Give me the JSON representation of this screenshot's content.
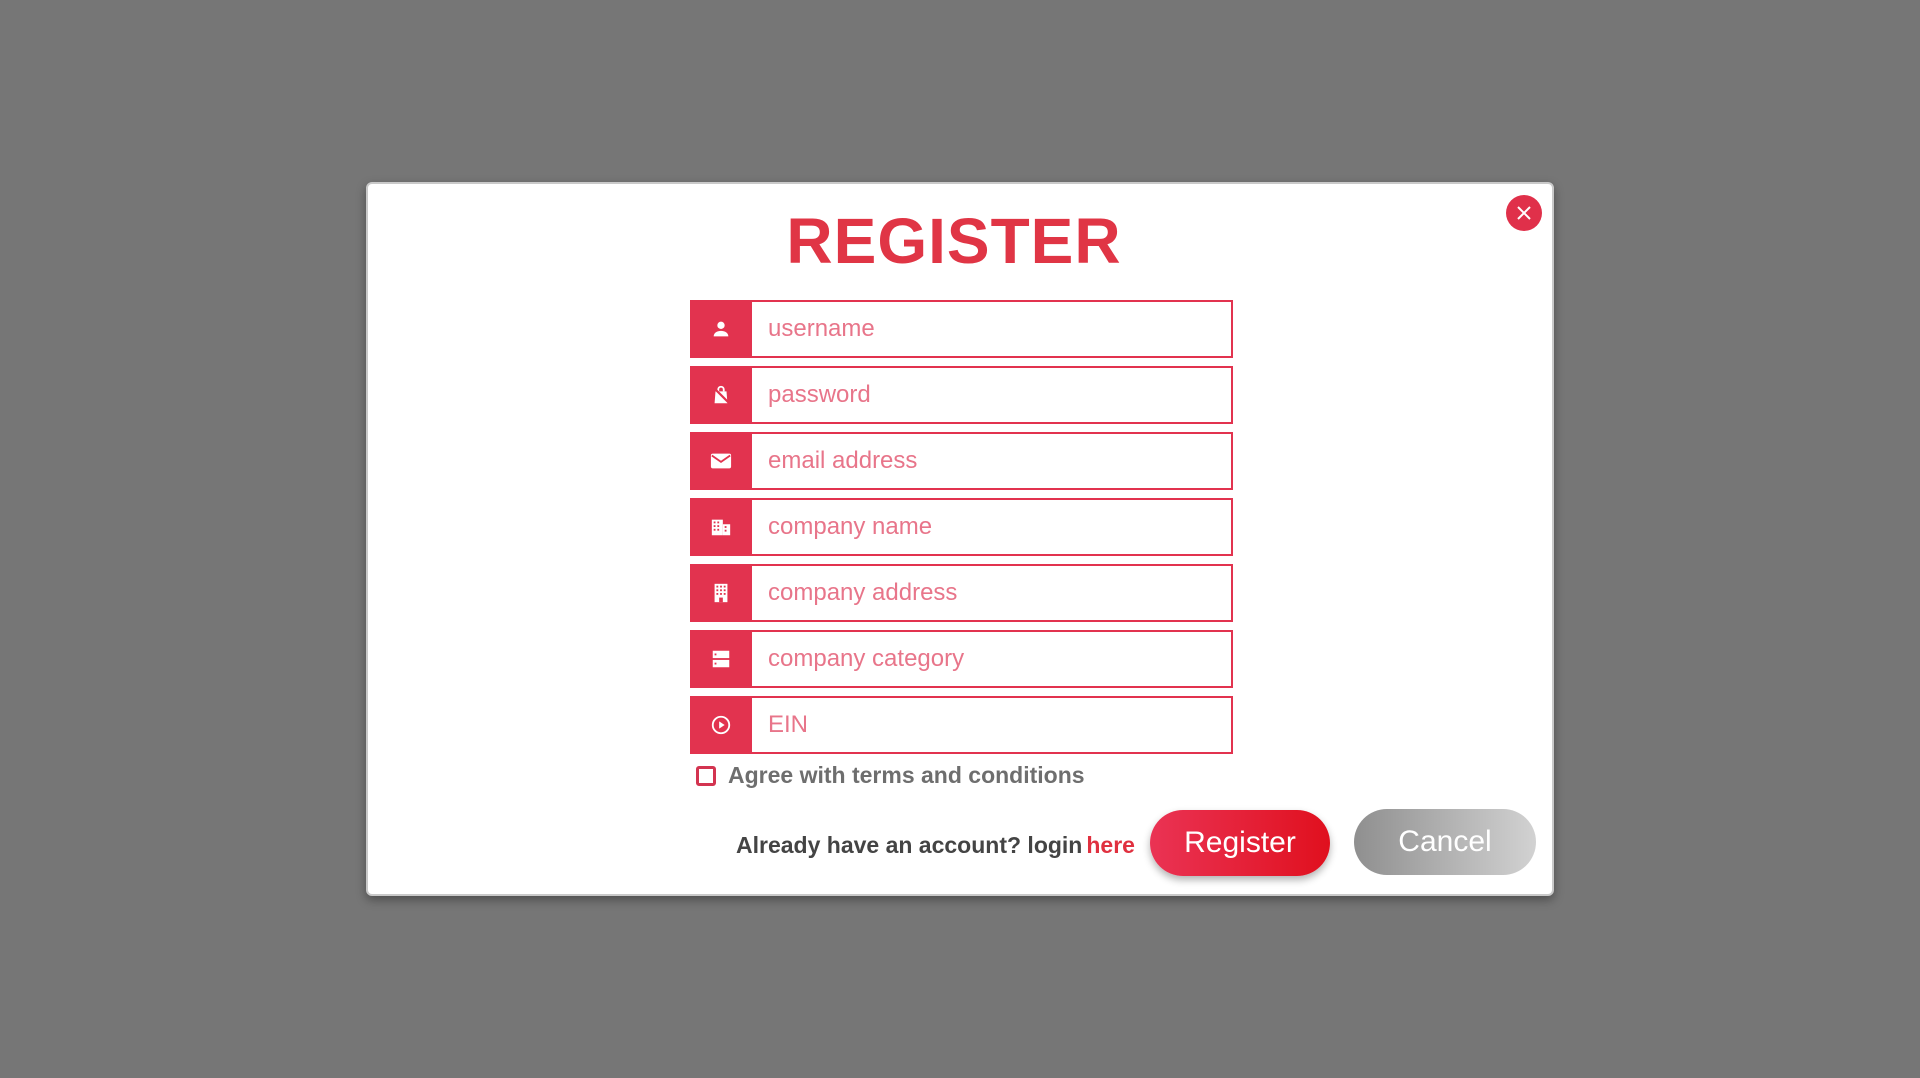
{
  "modal": {
    "title": "REGISTER",
    "close_icon": "close-icon"
  },
  "form": {
    "fields": [
      {
        "name": "username",
        "placeholder": "username",
        "value": "",
        "icon": "person-icon"
      },
      {
        "name": "password",
        "placeholder": "password",
        "value": "",
        "icon": "lock-bag-icon"
      },
      {
        "name": "email",
        "placeholder": "email address",
        "value": "",
        "icon": "envelope-icon"
      },
      {
        "name": "company-name",
        "placeholder": "company name",
        "value": "",
        "icon": "building-icon"
      },
      {
        "name": "company-address",
        "placeholder": "company address",
        "value": "",
        "icon": "apartment-icon"
      },
      {
        "name": "company-category",
        "placeholder": "company category",
        "value": "",
        "icon": "category-list-icon"
      },
      {
        "name": "ein",
        "placeholder": "EIN",
        "value": "",
        "icon": "circle-play-icon"
      }
    ],
    "agree_label": "Agree with terms and conditions",
    "agree_checked": false
  },
  "footer": {
    "login_prompt": "Already have an account? login",
    "login_link": "here",
    "register_label": "Register",
    "cancel_label": "Cancel"
  },
  "colors": {
    "accent": "#e2334f",
    "title": "#e03545",
    "overlay": "#767676",
    "placeholder": "#e8758a"
  }
}
